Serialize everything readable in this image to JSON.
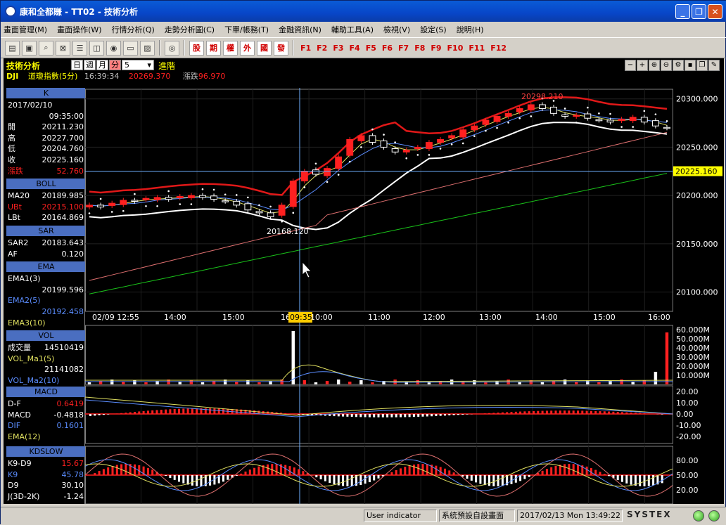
{
  "window": {
    "title": "康和全都賺 - TT02 - 技術分析"
  },
  "menu": [
    "畫面管理(M)",
    "畫面操作(W)",
    "行情分析(Q)",
    "走勢分析圖(C)",
    "下單/帳務(T)",
    "金融資訊(N)",
    "輔助工具(A)",
    "檢視(V)",
    "設定(S)",
    "說明(H)"
  ],
  "toolbar": {
    "trade_buttons": [
      "股",
      "期",
      "權",
      "外",
      "國",
      "發"
    ],
    "fkeys": [
      "F1",
      "F2",
      "F3",
      "F4",
      "F5",
      "F6",
      "F7",
      "F8",
      "F9",
      "F10",
      "F11",
      "F12"
    ]
  },
  "info": {
    "title": "技術分析",
    "periods": [
      "日",
      "週",
      "月",
      "分"
    ],
    "period_value": "5",
    "advanced": "進階",
    "symbol": "DJI",
    "name": "道瓊指數(5分)",
    "time": "16:39:34",
    "price": "20269.370",
    "change_label": "漲跌",
    "change": "96.970"
  },
  "panel": {
    "k": {
      "header": "K",
      "date": "2017/02/10",
      "time": "09:35:00",
      "rows": [
        {
          "label": "開",
          "value": "20211.230"
        },
        {
          "label": "高",
          "value": "20227.700"
        },
        {
          "label": "低",
          "value": "20204.760"
        },
        {
          "label": "收",
          "value": "20225.160"
        },
        {
          "label": "漲跌",
          "value": "52.760"
        }
      ]
    },
    "boll": {
      "header": "BOLL",
      "rows": [
        {
          "label": "MA20",
          "value": "20189.985"
        },
        {
          "label": "UBt",
          "value": "20215.100"
        },
        {
          "label": "LBt",
          "value": "20164.869"
        }
      ]
    },
    "sar": {
      "header": "SAR",
      "rows": [
        {
          "label": "SAR2",
          "value": "20183.643"
        },
        {
          "label": "AF",
          "value": "0.120"
        }
      ]
    },
    "ema": {
      "header": "EMA",
      "ema1_label": "EMA1(3)",
      "ema1_value": "20199.596",
      "ema2_label": "EMA2(5)",
      "ema2_value": "20192.458",
      "ema3_label": "EMA3(10)"
    },
    "vol": {
      "header": "VOL",
      "rows": [
        {
          "label": "成交量",
          "value": "14510419"
        }
      ],
      "ma1_label": "VOL_Ma1(5)",
      "ma1_value": "21141082",
      "ma2_label": "VOL_Ma2(10)"
    },
    "macd": {
      "header": "MACD",
      "rows": [
        {
          "label": "D-F",
          "value": "0.6419"
        },
        {
          "label": "MACD",
          "value": "-0.4818"
        },
        {
          "label": "DIF",
          "value": "0.1601"
        }
      ],
      "ema_label": "EMA(12)"
    },
    "kd": {
      "header": "KDSLOW",
      "rows": [
        {
          "label": "K9-D9",
          "value": "15.67"
        },
        {
          "label": "K9",
          "value": "45.78"
        },
        {
          "label": "D9",
          "value": "30.10"
        },
        {
          "label": "J(3D-2K)",
          "value": "-1.24"
        }
      ]
    }
  },
  "chart_data": {
    "type": "candlestick",
    "x_ticks": [
      "02/09 12:55",
      "14:00",
      "15:00",
      "16:00",
      "10:00",
      "11:00",
      "12:00",
      "13:00",
      "14:00",
      "15:00",
      "16:00"
    ],
    "cursor_time": "09:35",
    "cursor_price": "20225.160",
    "annotations": [
      {
        "text": "20298.210"
      },
      {
        "text": "20168.120"
      }
    ],
    "price_axis": {
      "ylim": [
        20080,
        20310
      ],
      "ticks": [
        "20300.000",
        "20250.000",
        "20200.000",
        "20150.000",
        "20100.000"
      ]
    },
    "volume_axis": {
      "ticks": [
        "60.000M",
        "50.000M",
        "40.000M",
        "30.000M",
        "20.000M",
        "10.000M"
      ]
    },
    "macd_axis": {
      "ticks": [
        "20.00",
        "10.00",
        "0.00",
        "-10.00",
        "-20.00"
      ]
    },
    "kd_axis": {
      "ticks": [
        "80.00",
        "50.00",
        "20.00"
      ]
    },
    "close_series": [
      20190,
      20188,
      20192,
      20195,
      20194,
      20197,
      20198,
      20196,
      20199,
      20200,
      20198,
      20196,
      20194,
      20190,
      20185,
      20182,
      20178,
      20190,
      20215,
      20225,
      20222,
      20228,
      20240,
      20258,
      20262,
      20255,
      20250,
      20245,
      20247,
      20250,
      20255,
      20258,
      20262,
      20268,
      20272,
      20278,
      20282,
      20285,
      20290,
      20294,
      20290,
      20285,
      20282,
      20283,
      20280,
      20278,
      20276,
      20279,
      20281,
      20276,
      20272,
      20270
    ],
    "colors": {
      "up": "#ff2020",
      "down": "#ffffff",
      "boll_upper": "#e01818",
      "boll_lower": "#ffffff",
      "sar": "#ffffff",
      "ma_green": "#19c019",
      "ma_pink": "#e07070"
    }
  },
  "status": {
    "indicator": "User indicator",
    "layout": "系統預設自設畫面",
    "datetime": "2017/02/13 Mon 13:49:22",
    "brand": "SYSTEX"
  }
}
